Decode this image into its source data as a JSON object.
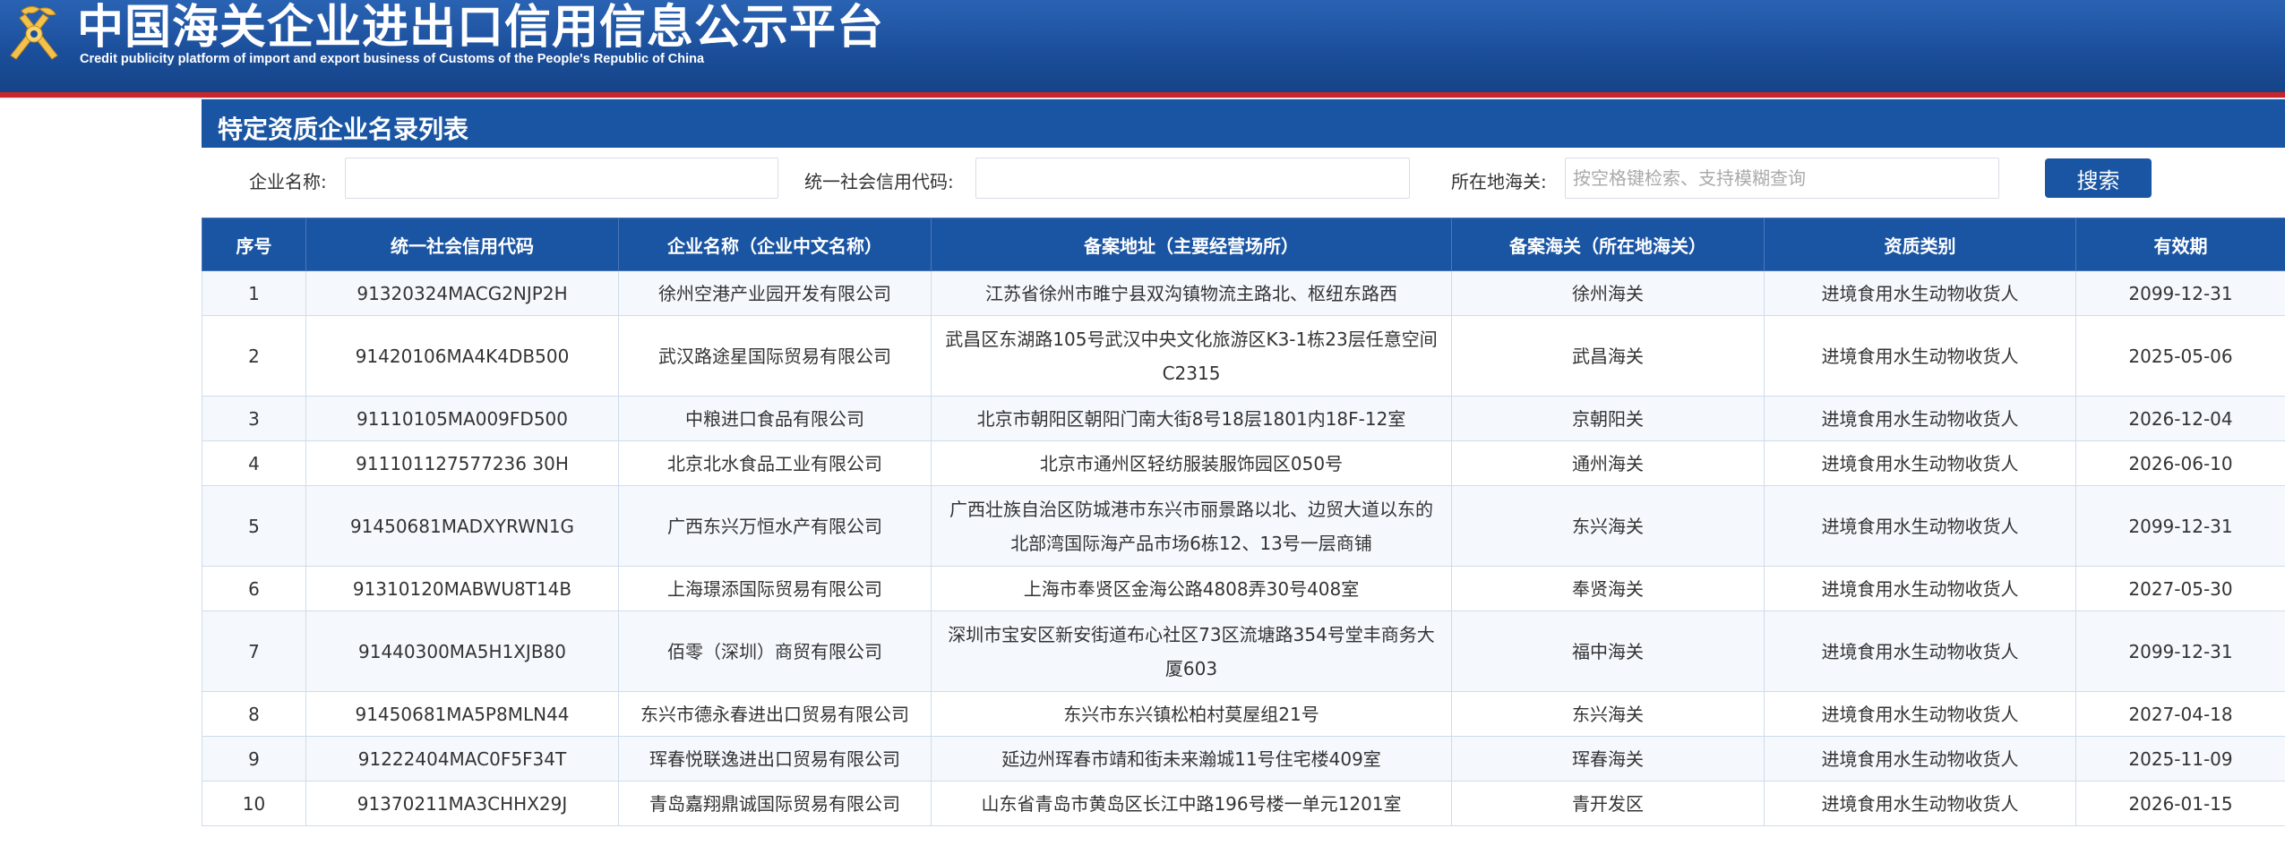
{
  "header": {
    "title": "中国海关企业进出口信用信息公示平台",
    "subtitle": "Credit publicity platform of import and export business of Customs of the People's Republic of China",
    "logo_icon": "customs-emblem-icon",
    "colors": {
      "banner": "#1b4f9c",
      "redline": "#c8242b"
    }
  },
  "panel": {
    "title": "特定资质企业名录列表",
    "accent": "#1a55a3"
  },
  "search": {
    "company_label": "企业名称:",
    "company_value": "",
    "code_label": "统一社会信用代码:",
    "code_value": "",
    "customs_label": "所在地海关:",
    "customs_placeholder": "按空格键检索、支持模糊查询",
    "button_label": "搜索"
  },
  "table": {
    "columns": [
      "序号",
      "统一社会信用代码",
      "企业名称（企业中文名称）",
      "备案地址（主要经营场所）",
      "备案海关（所在地海关）",
      "资质类别",
      "有效期"
    ],
    "rows": [
      {
        "no": "1",
        "code": "91320324MACG2NJP2H",
        "name": "徐州空港产业园开发有限公司",
        "address": "江苏省徐州市睢宁县双沟镇物流主路北、枢纽东路西",
        "customs": "徐州海关",
        "category": "进境食用水生动物收货人",
        "valid": "2099-12-31"
      },
      {
        "no": "2",
        "code": "91420106MA4K4DB500",
        "name": "武汉路途星国际贸易有限公司",
        "address": "武昌区东湖路105号武汉中央文化旅游区K3-1栋23层任意空间C2315",
        "customs": "武昌海关",
        "category": "进境食用水生动物收货人",
        "valid": "2025-05-06"
      },
      {
        "no": "3",
        "code": "91110105MA009FD500",
        "name": "中粮进口食品有限公司",
        "address": "北京市朝阳区朝阳门南大街8号18层1801内18F-12室",
        "customs": "京朝阳关",
        "category": "进境食用水生动物收货人",
        "valid": "2026-12-04"
      },
      {
        "no": "4",
        "code": "911101127577236 30H",
        "name": "北京北水食品工业有限公司",
        "address": "北京市通州区轻纺服装服饰园区050号",
        "customs": "通州海关",
        "category": "进境食用水生动物收货人",
        "valid": "2026-06-10"
      },
      {
        "no": "5",
        "code": "91450681MADXYRWN1G",
        "name": "广西东兴万恒水产有限公司",
        "address": "广西壮族自治区防城港市东兴市丽景路以北、边贸大道以东的北部湾国际海产品市场6栋12、13号一层商铺",
        "customs": "东兴海关",
        "category": "进境食用水生动物收货人",
        "valid": "2099-12-31"
      },
      {
        "no": "6",
        "code": "91310120MABWU8T14B",
        "name": "上海璟添国际贸易有限公司",
        "address": "上海市奉贤区金海公路4808弄30号408室",
        "customs": "奉贤海关",
        "category": "进境食用水生动物收货人",
        "valid": "2027-05-30"
      },
      {
        "no": "7",
        "code": "91440300MA5H1XJB80",
        "name": "佰零（深圳）商贸有限公司",
        "address": "深圳市宝安区新安街道布心社区73区流塘路354号堂丰商务大厦603",
        "customs": "福中海关",
        "category": "进境食用水生动物收货人",
        "valid": "2099-12-31"
      },
      {
        "no": "8",
        "code": "91450681MA5P8MLN44",
        "name": "东兴市德永春进出口贸易有限公司",
        "address": "东兴市东兴镇松柏村莫屋组21号",
        "customs": "东兴海关",
        "category": "进境食用水生动物收货人",
        "valid": "2027-04-18"
      },
      {
        "no": "9",
        "code": "91222404MAC0F5F34T",
        "name": "珲春悦联逸进出口贸易有限公司",
        "address": "延边州珲春市靖和街未来瀚城11号住宅楼409室",
        "customs": "珲春海关",
        "category": "进境食用水生动物收货人",
        "valid": "2025-11-09"
      },
      {
        "no": "10",
        "code": "91370211MA3CHHX29J",
        "name": "青岛嘉翔鼎诚国际贸易有限公司",
        "address": "山东省青岛市黄岛区长江中路196号楼一单元1201室",
        "customs": "青开发区",
        "category": "进境食用水生动物收货人",
        "valid": "2026-01-15"
      }
    ]
  }
}
